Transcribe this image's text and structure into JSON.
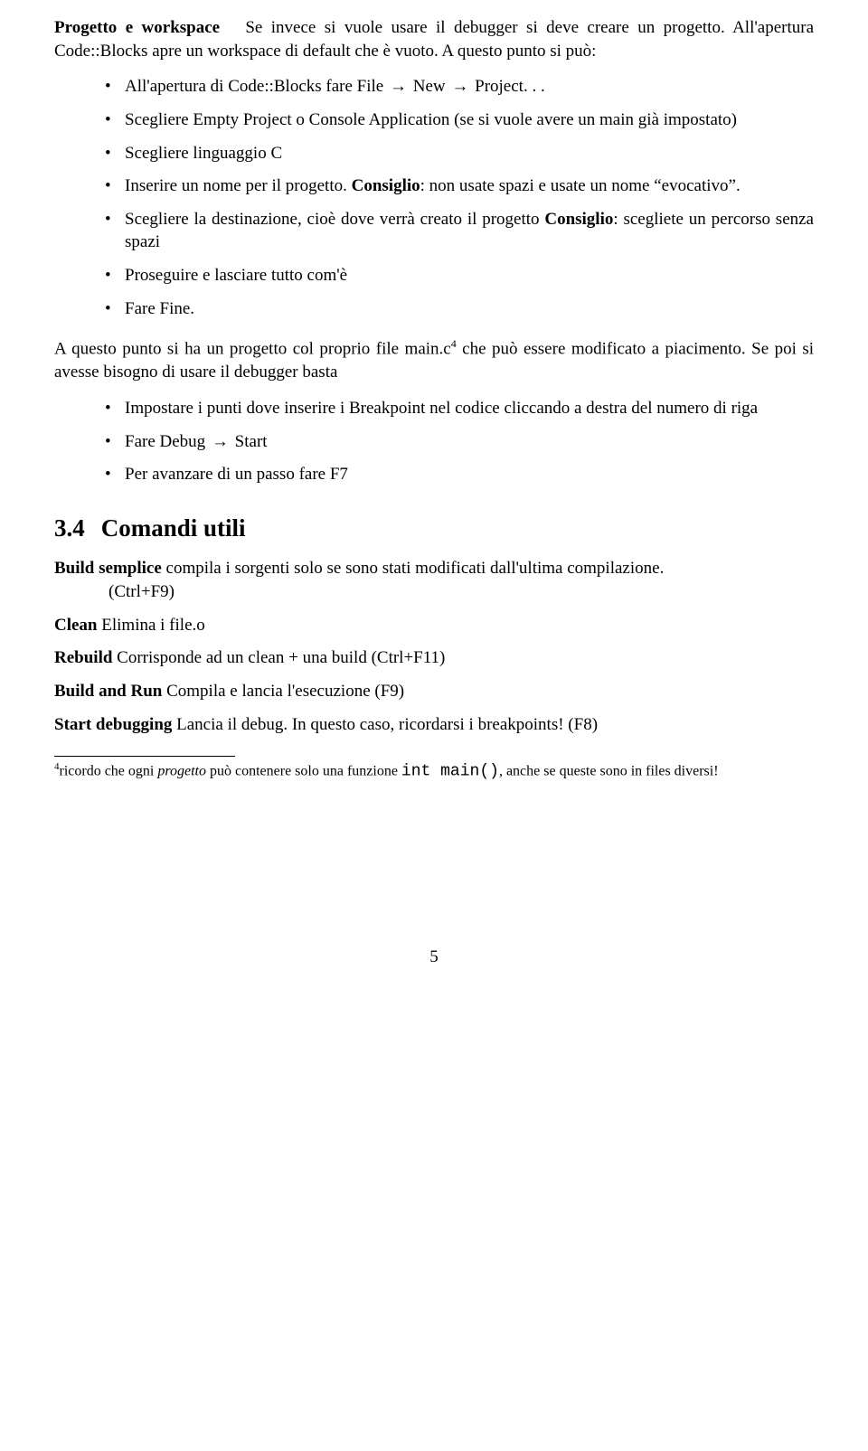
{
  "intro": {
    "runin": "Progetto e workspace",
    "text": "Se invece si vuole usare il debugger si deve creare un progetto. All'apertura Code::Blocks apre un workspace di default che è vuoto. A questo punto si può:"
  },
  "arrow": "→",
  "list1": {
    "i0a": "All'apertura di Code::Blocks fare File ",
    "i0b": " New ",
    "i0c": " Project. . .",
    "i1": "Scegliere Empty Project o Console Application (se si vuole avere un main già impostato)",
    "i2": "Scegliere linguaggio C",
    "i3a": "Inserire un nome per il progetto. ",
    "i3bold": "Consiglio",
    "i3b": ": non usate spazi e usate un nome ",
    "i3q": "evocativo",
    "i3c": ".",
    "i4a": "Scegliere la destinazione, cioè dove verrà creato il progetto ",
    "i4bold": "Consiglio",
    "i4b": ": scegliete un percorso senza spazi",
    "i5": "Proseguire e lasciare tutto com'è",
    "i6": "Fare Fine."
  },
  "mid": {
    "a": "A questo punto si ha un progetto col proprio file main.c",
    "sup": "4",
    "b": " che può essere modificato a piacimento. Se poi si avesse bisogno di usare il debugger basta"
  },
  "list2": {
    "i0": "Impostare i punti dove inserire i Breakpoint nel codice cliccando a destra del numero di riga",
    "i1a": "Fare Debug ",
    "i1b": " Start",
    "i2": "Per avanzare di un passo fare F7"
  },
  "section": {
    "num": "3.4",
    "title": "Comandi utili"
  },
  "dl": {
    "t0": "Build semplice",
    "d0a": " compila i sorgenti solo se sono stati modificati dall'ultima compilazione.",
    "d0b": "(Ctrl+F9)",
    "t1": "Clean",
    "d1": " Elimina i file.o",
    "t2": "Rebuild",
    "d2": " Corrisponde ad un clean + una build (Ctrl+F11)",
    "t3": "Build and Run",
    "d3": " Compila e lancia l'esecuzione (F9)",
    "t4": "Start debugging",
    "d4": " Lancia il debug. In questo caso, ricordarsi i breakpoints! (F8)"
  },
  "footnote": {
    "num": "4",
    "a": "ricordo che ogni ",
    "it": "progetto",
    "b": " può contenere solo una funzione ",
    "tt": "int main()",
    "c": ", anche se queste sono in files diversi!"
  },
  "page": "5"
}
